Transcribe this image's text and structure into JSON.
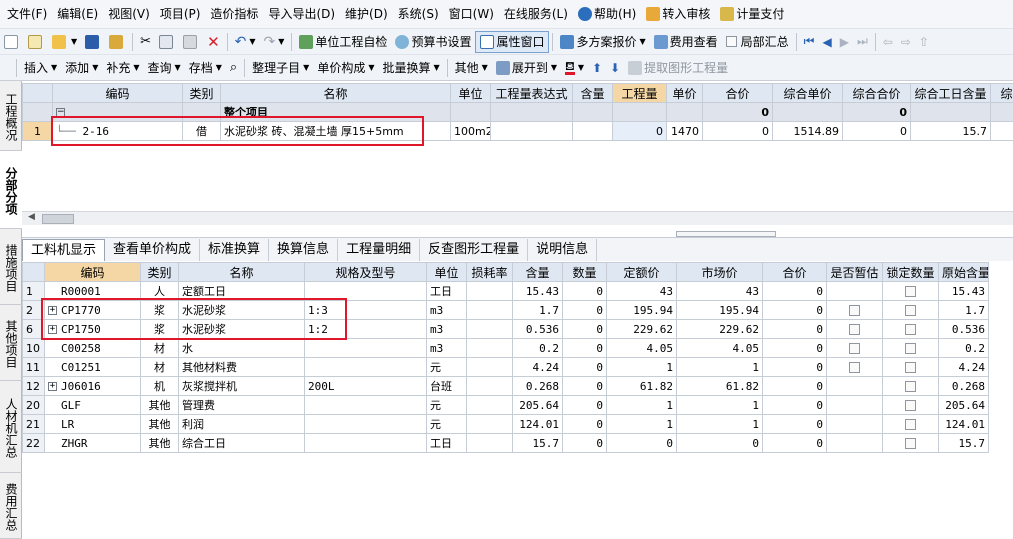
{
  "menu": [
    "文件(F)",
    "编辑(E)",
    "视图(V)",
    "项目(P)",
    "造价指标",
    "导入导出(D)",
    "维护(D)",
    "系统(S)",
    "窗口(W)",
    "在线服务(L)",
    "帮助(H)",
    "转入审核",
    "计量支付"
  ],
  "toolbar1": {
    "unit_check": "单位工程自检",
    "budget_settings": "预算书设置",
    "property_window": "属性窗口",
    "multi_quote": "多方案报价",
    "fee_view": "费用查看",
    "partial_summary": "局部汇总"
  },
  "toolbar2": {
    "insert": "插入",
    "add": "添加",
    "supplement": "补充",
    "query": "查询",
    "archive": "存档",
    "organize": "整理子目",
    "unit_composition": "单价构成",
    "batch_convert": "批量换算",
    "other": "其他",
    "expand_to": "展开到",
    "extract_quantity": "提取图形工程量"
  },
  "sidebar": [
    "工程概况",
    "分部分项",
    "措施项目",
    "其他项目",
    "人材机汇总",
    "费用汇总"
  ],
  "upper": {
    "headers": [
      "编码",
      "类别",
      "名称",
      "单位",
      "工程量表达式",
      "含量",
      "工程量",
      "单价",
      "合价",
      "综合单价",
      "综合合价",
      "综合工日含量",
      "综"
    ],
    "group": {
      "name": "整个项目",
      "amount": "0",
      "total_amount": "0"
    },
    "row": {
      "index": "1",
      "code": "2-16",
      "type": "借",
      "name": "水泥砂浆 砖、混凝土墙 厚15+5mm",
      "unit": "100m2",
      "expr": "",
      "content": "",
      "quantity": "0",
      "price": "1470",
      "total": "0",
      "comp_price": "1514.89",
      "comp_total": "0",
      "labor_content": "15.7"
    }
  },
  "tabs": [
    "工料机显示",
    "查看单价构成",
    "标准换算",
    "换算信息",
    "工程量明细",
    "反查图形工程量",
    "说明信息"
  ],
  "lower": {
    "headers": [
      "编码",
      "类别",
      "名称",
      "规格及型号",
      "单位",
      "损耗率",
      "含量",
      "数量",
      "定额价",
      "市场价",
      "合价",
      "是否暂估",
      "锁定数量",
      "原始含量"
    ],
    "rows": [
      {
        "idx": "1",
        "code": "R00001",
        "type": "人",
        "name": "定额工日",
        "spec": "",
        "unit": "工日",
        "content": "15.43",
        "qty": "0",
        "base": "43",
        "market": "43",
        "total": "0",
        "orig": "15.43"
      },
      {
        "idx": "2",
        "code": "CP1770",
        "type": "浆",
        "name": "水泥砂浆",
        "spec": "1:3",
        "unit": "m3",
        "content": "1.7",
        "qty": "0",
        "base": "195.94",
        "market": "195.94",
        "total": "0",
        "orig": "1.7"
      },
      {
        "idx": "6",
        "code": "CP1750",
        "type": "浆",
        "name": "水泥砂浆",
        "spec": "1:2",
        "unit": "m3",
        "content": "0.536",
        "qty": "0",
        "base": "229.62",
        "market": "229.62",
        "total": "0",
        "orig": "0.536"
      },
      {
        "idx": "10",
        "code": "C00258",
        "type": "材",
        "name": "水",
        "spec": "",
        "unit": "m3",
        "content": "0.2",
        "qty": "0",
        "base": "4.05",
        "market": "4.05",
        "total": "0",
        "orig": "0.2"
      },
      {
        "idx": "11",
        "code": "C01251",
        "type": "材",
        "name": "其他材料费",
        "spec": "",
        "unit": "元",
        "content": "4.24",
        "qty": "0",
        "base": "1",
        "market": "1",
        "total": "0",
        "orig": "4.24"
      },
      {
        "idx": "12",
        "code": "J06016",
        "type": "机",
        "name": "灰浆搅拌机",
        "spec": "200L",
        "unit": "台班",
        "content": "0.268",
        "qty": "0",
        "base": "61.82",
        "market": "61.82",
        "total": "0",
        "orig": "0.268"
      },
      {
        "idx": "20",
        "code": "GLF",
        "type": "其他",
        "name": "管理费",
        "spec": "",
        "unit": "元",
        "content": "205.64",
        "qty": "0",
        "base": "1",
        "market": "1",
        "total": "0",
        "orig": "205.64"
      },
      {
        "idx": "21",
        "code": "LR",
        "type": "其他",
        "name": "利润",
        "spec": "",
        "unit": "元",
        "content": "124.01",
        "qty": "0",
        "base": "1",
        "market": "1",
        "total": "0",
        "orig": "124.01"
      },
      {
        "idx": "22",
        "code": "ZHGR",
        "type": "其他",
        "name": "综合工日",
        "spec": "",
        "unit": "工日",
        "content": "15.7",
        "qty": "0",
        "base": "0",
        "market": "0",
        "total": "0",
        "orig": "15.7"
      }
    ]
  }
}
